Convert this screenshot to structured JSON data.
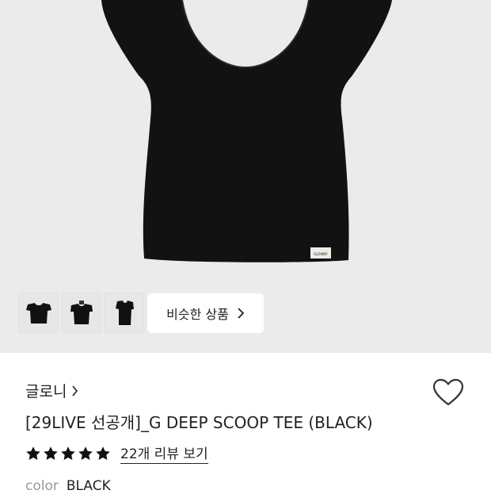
{
  "gallery": {
    "thumbnails": [
      "tee-front",
      "tee-worn-front",
      "tee-side"
    ],
    "similar_button": "비슷한 상품"
  },
  "product": {
    "brand": "글로니",
    "title": "[29LIVE 선공개]_G DEEP SCOOP TEE (BLACK)",
    "rating": 5,
    "review_link": "22개 리뷰 보기",
    "color_label": "color",
    "color_value": "BLACK",
    "label_tag": "GLOWNY"
  },
  "colors": {
    "hero_bg": "#ebebeb",
    "garment": "#111111"
  }
}
